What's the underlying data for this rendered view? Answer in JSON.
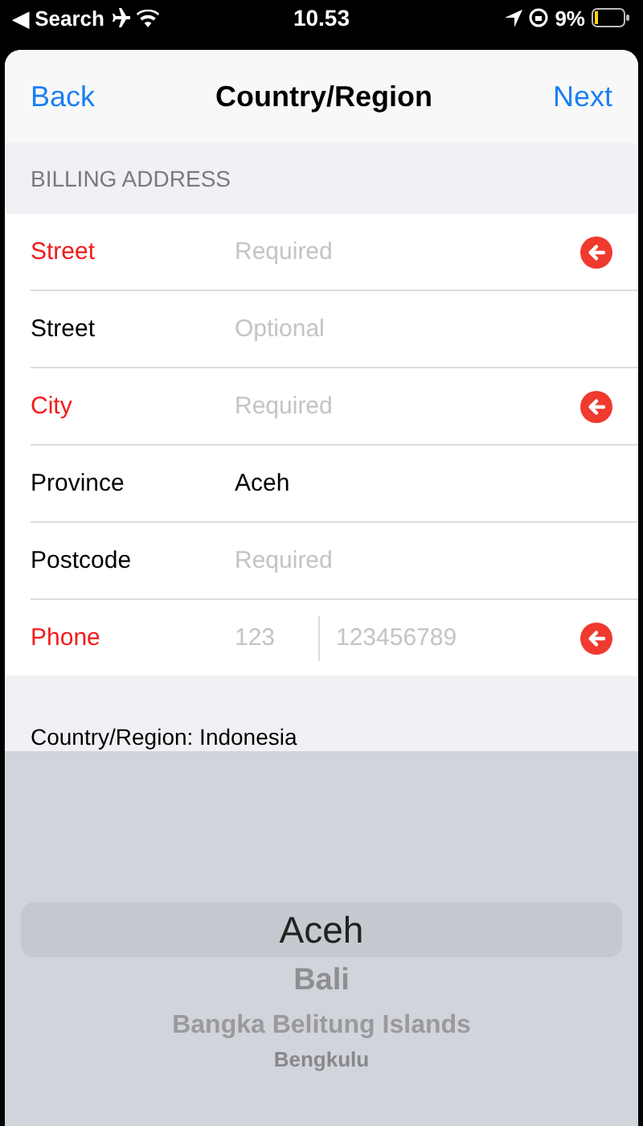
{
  "status_bar": {
    "back_label": "◀ Search",
    "time": "10.53",
    "battery": "9%"
  },
  "nav": {
    "back": "Back",
    "title": "Country/Region",
    "next": "Next"
  },
  "section_header": "BILLING ADDRESS",
  "fields": [
    {
      "kind": "text",
      "label": "Street",
      "placeholder": "Required",
      "invalid": true
    },
    {
      "kind": "text",
      "label": "Street",
      "placeholder": "Optional",
      "invalid": false
    },
    {
      "kind": "text",
      "label": "City",
      "placeholder": "Required",
      "invalid": true
    },
    {
      "kind": "text",
      "label": "Province",
      "value": "Aceh",
      "invalid": false
    },
    {
      "kind": "text",
      "label": "Postcode",
      "placeholder": "Required",
      "invalid": false
    },
    {
      "kind": "phone",
      "label": "Phone",
      "code_placeholder": "123",
      "placeholder": "123456789",
      "invalid": true
    }
  ],
  "country_note": "Country/Region: Indonesia",
  "picker": [
    {
      "label": "Aceh",
      "selected": true
    },
    {
      "label": "Bali",
      "selected": false
    },
    {
      "label": "Bangka Belitung Islands",
      "selected": false
    },
    {
      "label": "Bengkulu",
      "selected": false
    }
  ]
}
